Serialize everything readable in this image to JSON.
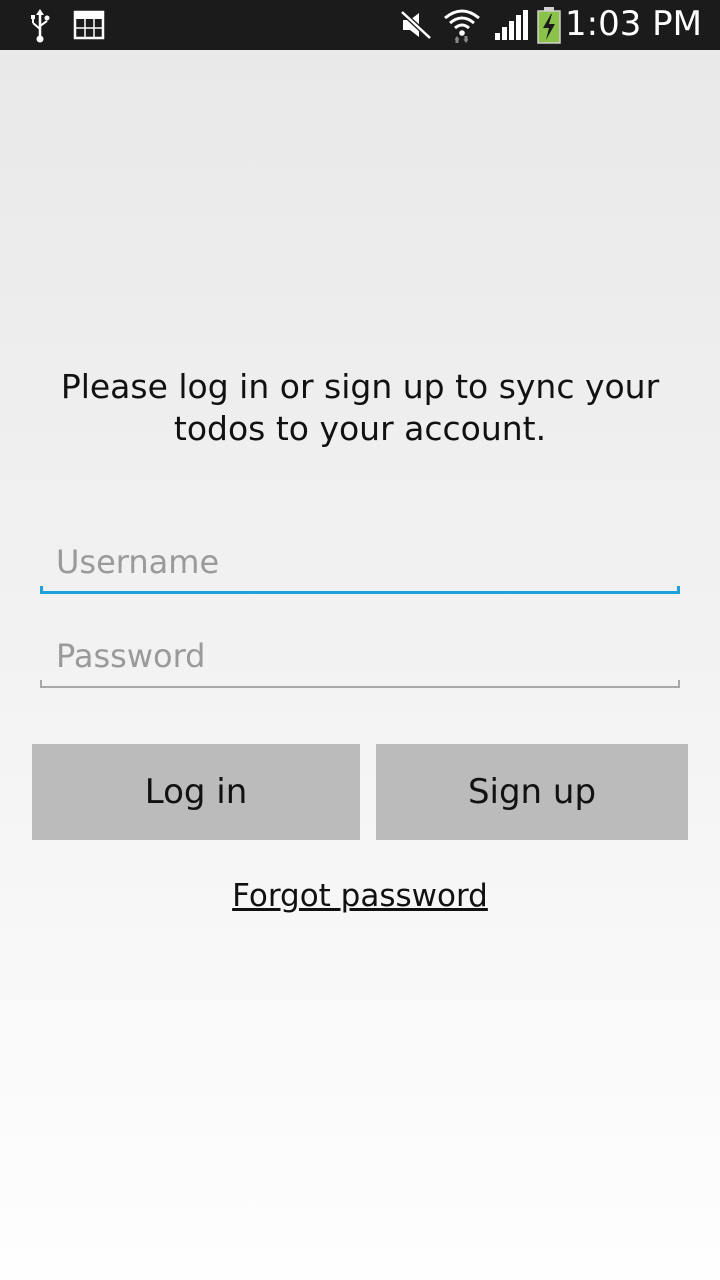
{
  "status_bar": {
    "time": "1:03 PM",
    "icons": [
      "usb-icon",
      "screenshot-gallery-icon",
      "mute-icon",
      "wifi-icon",
      "signal-icon",
      "battery-charging-icon"
    ],
    "battery_color": "#8bc34a"
  },
  "login": {
    "prompt": "Please log in or sign up to sync your todos to your account.",
    "username": {
      "value": "",
      "placeholder": "Username"
    },
    "password": {
      "value": "",
      "placeholder": "Password"
    },
    "login_label": "Log in",
    "signup_label": "Sign up",
    "forgot_label": "Forgot password"
  },
  "colors": {
    "focus_accent": "#1fa0d8",
    "button_background": "#bbbbbb"
  }
}
